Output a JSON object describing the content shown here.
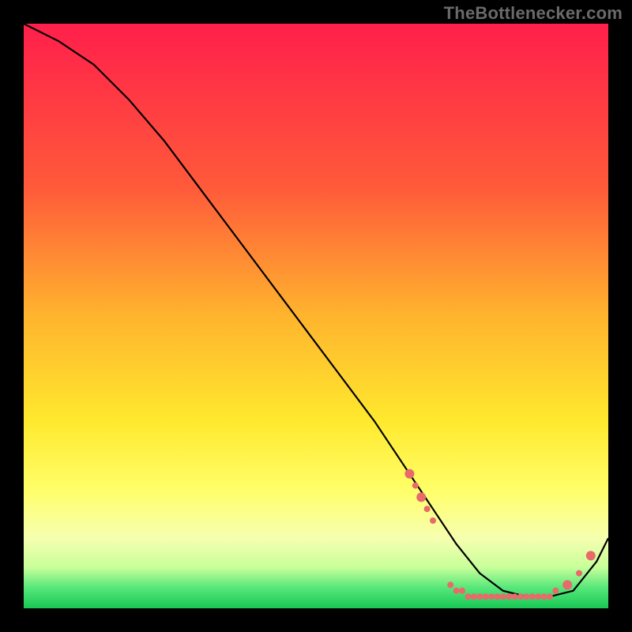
{
  "watermark": "TheBottlenecker.com",
  "chart_data": {
    "type": "line",
    "title": "",
    "xlabel": "",
    "ylabel": "",
    "xlim": [
      0,
      100
    ],
    "ylim": [
      0,
      100
    ],
    "gradient_stops": [
      {
        "offset": 0,
        "color": "#ff1f4b"
      },
      {
        "offset": 0.28,
        "color": "#ff5a3a"
      },
      {
        "offset": 0.5,
        "color": "#ffb42e"
      },
      {
        "offset": 0.68,
        "color": "#ffe92e"
      },
      {
        "offset": 0.8,
        "color": "#ffff6a"
      },
      {
        "offset": 0.88,
        "color": "#f6ffb0"
      },
      {
        "offset": 0.93,
        "color": "#c8ff9a"
      },
      {
        "offset": 0.965,
        "color": "#56e77a"
      },
      {
        "offset": 1.0,
        "color": "#18c755"
      }
    ],
    "series": [
      {
        "name": "bottleneck-curve",
        "x": [
          0,
          6,
          12,
          18,
          24,
          30,
          36,
          42,
          48,
          54,
          60,
          66,
          70,
          74,
          78,
          82,
          86,
          90,
          94,
          98,
          100
        ],
        "y": [
          100,
          97,
          93,
          87,
          80,
          72,
          64,
          56,
          48,
          40,
          32,
          23,
          17,
          11,
          6,
          3,
          2,
          2,
          3,
          8,
          12
        ]
      }
    ],
    "markers": {
      "name": "optimal-range-dots",
      "color": "#e86a6a",
      "radius_small": 4,
      "radius_large": 6,
      "points": [
        {
          "x": 66,
          "y": 23,
          "r": "large"
        },
        {
          "x": 67,
          "y": 21,
          "r": "small"
        },
        {
          "x": 68,
          "y": 19,
          "r": "large"
        },
        {
          "x": 69,
          "y": 17,
          "r": "small"
        },
        {
          "x": 70,
          "y": 15,
          "r": "small"
        },
        {
          "x": 73,
          "y": 4,
          "r": "small"
        },
        {
          "x": 74,
          "y": 3,
          "r": "small"
        },
        {
          "x": 75,
          "y": 3,
          "r": "small"
        },
        {
          "x": 76,
          "y": 2,
          "r": "small"
        },
        {
          "x": 77,
          "y": 2,
          "r": "small"
        },
        {
          "x": 78,
          "y": 2,
          "r": "small"
        },
        {
          "x": 79,
          "y": 2,
          "r": "small"
        },
        {
          "x": 80,
          "y": 2,
          "r": "small"
        },
        {
          "x": 81,
          "y": 2,
          "r": "small"
        },
        {
          "x": 82,
          "y": 2,
          "r": "small"
        },
        {
          "x": 83,
          "y": 2,
          "r": "small"
        },
        {
          "x": 84,
          "y": 2,
          "r": "small"
        },
        {
          "x": 85,
          "y": 2,
          "r": "small"
        },
        {
          "x": 86,
          "y": 2,
          "r": "small"
        },
        {
          "x": 87,
          "y": 2,
          "r": "small"
        },
        {
          "x": 88,
          "y": 2,
          "r": "small"
        },
        {
          "x": 89,
          "y": 2,
          "r": "small"
        },
        {
          "x": 90,
          "y": 2,
          "r": "small"
        },
        {
          "x": 91,
          "y": 3,
          "r": "small"
        },
        {
          "x": 93,
          "y": 4,
          "r": "large"
        },
        {
          "x": 95,
          "y": 6,
          "r": "small"
        },
        {
          "x": 97,
          "y": 9,
          "r": "large"
        }
      ]
    }
  }
}
